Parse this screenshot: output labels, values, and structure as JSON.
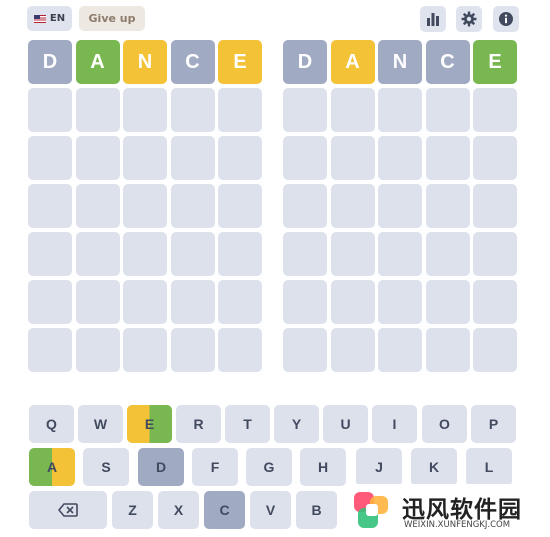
{
  "header": {
    "language_label": "EN",
    "give_up_label": "Give up",
    "icons": [
      "stats-icon",
      "settings-gear-icon",
      "info-icon"
    ]
  },
  "boards": [
    {
      "guesses": [
        {
          "letters": [
            "D",
            "A",
            "N",
            "C",
            "E"
          ],
          "states": [
            "gray",
            "green",
            "yellow",
            "gray",
            "yellow"
          ]
        }
      ],
      "total_rows": 7
    },
    {
      "guesses": [
        {
          "letters": [
            "D",
            "A",
            "N",
            "C",
            "E"
          ],
          "states": [
            "gray",
            "yellow",
            "gray",
            "gray",
            "green"
          ]
        }
      ],
      "total_rows": 7
    }
  ],
  "keyboard": {
    "rows": [
      [
        {
          "label": "Q",
          "state": "default"
        },
        {
          "label": "W",
          "state": "default"
        },
        {
          "label": "E",
          "state": "yellow-green"
        },
        {
          "label": "R",
          "state": "default"
        },
        {
          "label": "T",
          "state": "default"
        },
        {
          "label": "Y",
          "state": "default"
        },
        {
          "label": "U",
          "state": "default"
        },
        {
          "label": "I",
          "state": "default"
        },
        {
          "label": "O",
          "state": "default"
        },
        {
          "label": "P",
          "state": "default"
        }
      ],
      [
        {
          "label": "A",
          "state": "green-yellow"
        },
        {
          "label": "S",
          "state": "default"
        },
        {
          "label": "D",
          "state": "gray"
        },
        {
          "label": "F",
          "state": "default"
        },
        {
          "label": "G",
          "state": "default"
        },
        {
          "label": "H",
          "state": "default"
        },
        {
          "label": "J",
          "state": "default"
        },
        {
          "label": "K",
          "state": "default"
        },
        {
          "label": "L",
          "state": "default"
        }
      ],
      [
        {
          "label": "⌫",
          "state": "default",
          "icon": "backspace-icon"
        },
        {
          "label": "Z",
          "state": "default"
        },
        {
          "label": "X",
          "state": "default"
        },
        {
          "label": "C",
          "state": "gray"
        },
        {
          "label": "V",
          "state": "default"
        },
        {
          "label": "B",
          "state": "default"
        }
      ]
    ]
  },
  "colors": {
    "green": "#79b851",
    "yellow": "#f3c237",
    "gray": "#a1aac3",
    "empty": "#dde1ec"
  },
  "watermark": {
    "brand": "迅风软件园",
    "url": "WEIXIN.XUNFENGKJ.COM"
  }
}
